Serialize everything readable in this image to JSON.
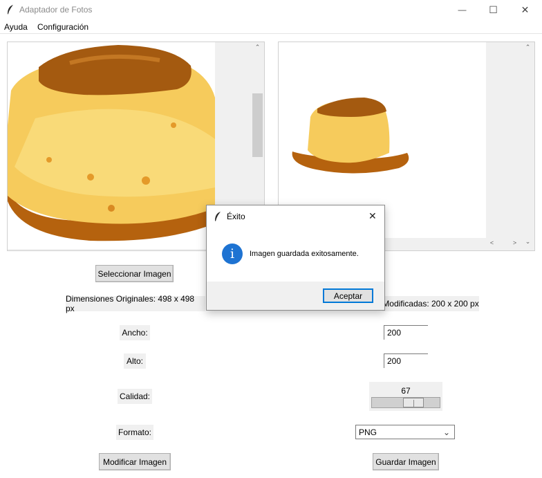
{
  "window": {
    "title": "Adaptador de Fotos",
    "minimize_glyph": "—",
    "maximize_glyph": "☐",
    "close_glyph": "✕"
  },
  "menu": {
    "items": [
      {
        "label": "Ayuda"
      },
      {
        "label": "Configuración"
      }
    ]
  },
  "scroll": {
    "up": "⌃",
    "down": "⌄",
    "left": "<",
    "right": ">"
  },
  "buttons": {
    "select": "Seleccionar Imagen",
    "modify": "Modificar Imagen",
    "save": "Guardar Imagen"
  },
  "labels": {
    "original_dims": "Dimensiones Originales: 498 x 498 px",
    "modified_dims": "Modificadas: 200 x 200 px",
    "width": "Ancho:",
    "height": "Alto:",
    "quality": "Calidad:",
    "format": "Formato:"
  },
  "inputs": {
    "width_value": "200",
    "height_value": "200"
  },
  "quality": {
    "value": "67",
    "min": 1,
    "max": 100
  },
  "format": {
    "selected": "PNG",
    "arrow": "⌄"
  },
  "dialog": {
    "title": "Éxito",
    "message": "Imagen guardada exitosamente.",
    "ok_label": "Aceptar",
    "close_glyph": "✕",
    "info_glyph": "i"
  },
  "colors": {
    "accent": "#1e73d2",
    "caramel": "#b5620e",
    "flan": "#f6cb5c"
  }
}
